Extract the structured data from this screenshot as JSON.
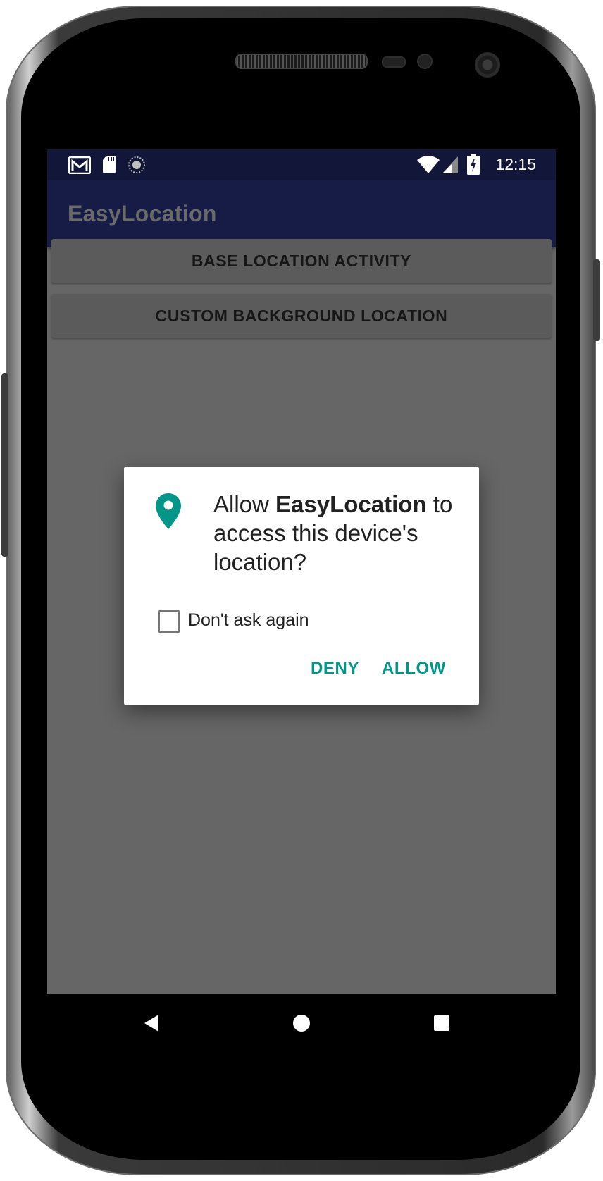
{
  "status_bar": {
    "time": "12:15",
    "left_icons": [
      "gmail-icon",
      "sd-card-icon",
      "sync-icon"
    ],
    "right_icons": [
      "wifi-icon",
      "signal-icon",
      "battery-charging-icon"
    ]
  },
  "app_bar": {
    "title": "EasyLocation"
  },
  "main": {
    "buttons": [
      {
        "label": "BASE LOCATION ACTIVITY"
      },
      {
        "label": "CUSTOM BACKGROUND LOCATION"
      }
    ]
  },
  "dialog": {
    "message_pre": "Allow ",
    "app_name": "EasyLocation",
    "message_post": " to access this device's location?",
    "checkbox_label": "Don't ask again",
    "checkbox_checked": false,
    "deny_label": "DENY",
    "allow_label": "ALLOW",
    "accent_color": "#009688"
  },
  "nav_bar": {
    "icons": [
      "back-icon",
      "home-icon",
      "recents-icon"
    ]
  }
}
